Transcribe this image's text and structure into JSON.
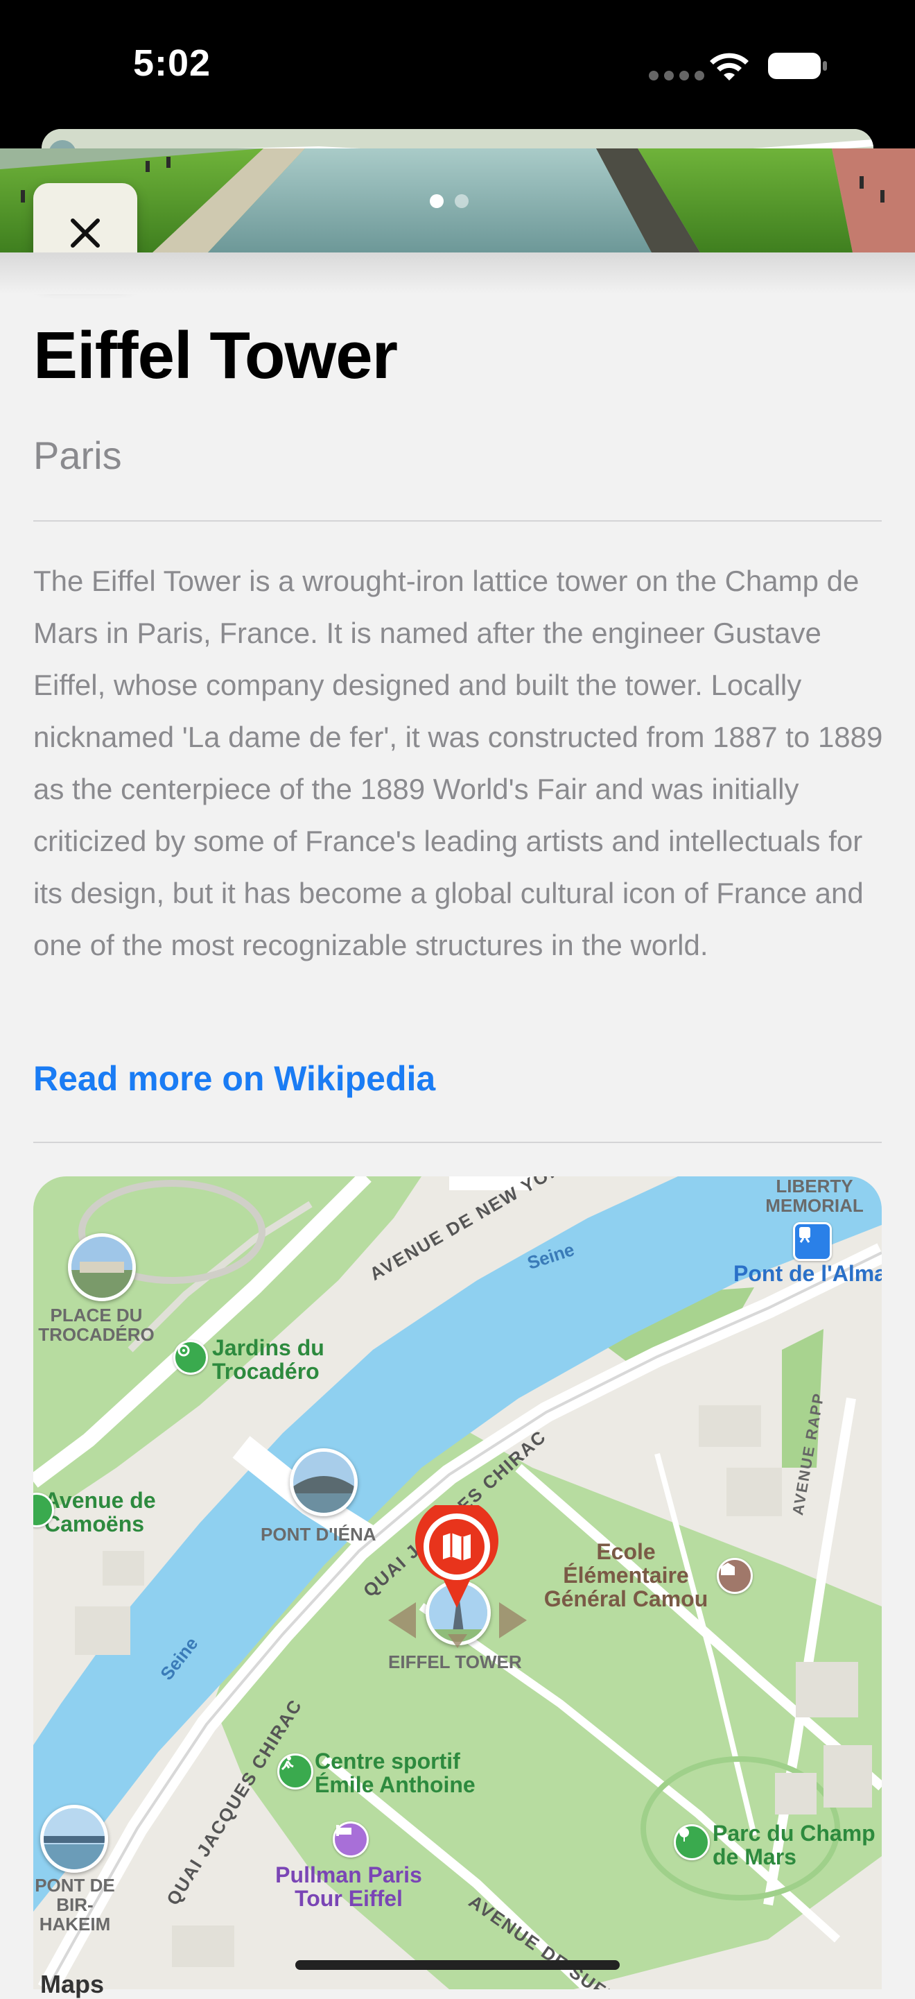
{
  "status_bar": {
    "time": "5:02"
  },
  "hero": {
    "page_count": 2,
    "active_page": 1,
    "colors": {
      "grass": "#4f9a2a",
      "water": "#8fb7b8",
      "path": "#c47b6e"
    }
  },
  "close_button": {
    "icon": "close-icon"
  },
  "place": {
    "title": "Eiffel Tower",
    "subtitle": "Paris",
    "description": "The Eiffel Tower is a wrought-iron lattice tower on the Champ de Mars in Paris, France. It is named after the engineer Gustave Eiffel, whose company designed and built the tower. Locally nicknamed 'La dame de fer', it was constructed from 1887 to 1889 as the centerpiece of the 1889 World's Fair and was initially criticized by some of France's leading artists and intellectuals for its design, but it has become a global cultural icon of France and one of the most recognizable structures in the world.",
    "wiki_link": "Read more on Wikipedia"
  },
  "map": {
    "labels": {
      "avenue_new_york": "AVENUE DE NEW YORK",
      "liberty_memorial": "LIBERTY MEMORIAL",
      "seine_1": "Seine",
      "seine_2": "Seine",
      "pont_alma": "Pont de l'Alma",
      "place_trocadero": "PLACE DU TROCADÉRO",
      "jardins_trocadero": "Jardins du Trocadéro",
      "avenue_rapp": "AVENUE RAPP",
      "quai_chirac_1": "QUAI JACQUES CHIRAC",
      "quai_chirac_2": "QUAI JACQUES CHIRAC",
      "avenue_camoens": "Avenue de Camoëns",
      "pont_iena": "PONT D'IÉNA",
      "ecole": "Ecole Élémentaire Général Camou",
      "eiffel_tower": "EIFFEL TOWER",
      "centre_sportif": "Centre sportif Émile Anthoine",
      "pullman": "Pullman Paris Tour Eiffel",
      "parc_champ": "Parc du Champ de Mars",
      "pont_bir_hakeim": "PONT DE BIR-HAKEIM",
      "avenue_suffren": "AVENUE DE SUFFREN",
      "maps_logo": "Maps"
    },
    "colors": {
      "water": "#8fd0f0",
      "park": "#b7dca0",
      "land": "#eceae4",
      "road": "#ffffff",
      "pin": "#e8341c"
    }
  }
}
